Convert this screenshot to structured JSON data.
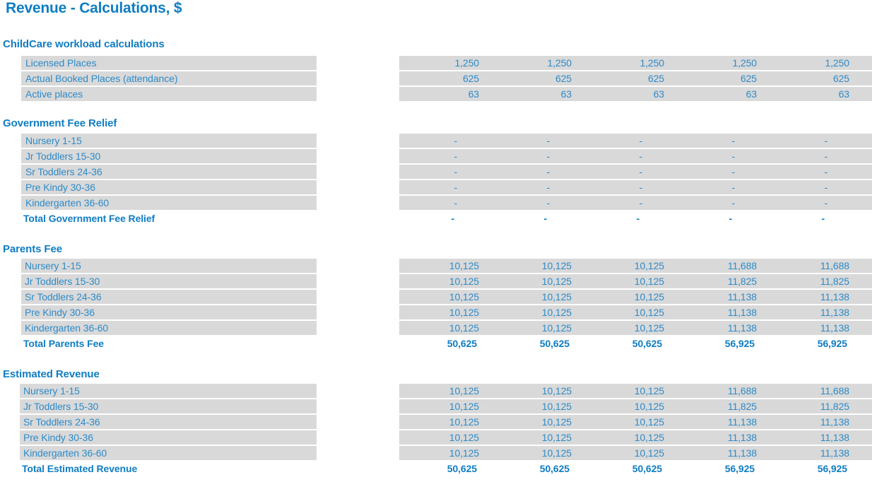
{
  "title": "Revenue - Calculations, $",
  "colors": {
    "heading_blue": "#0f7dc2",
    "body_blue": "#2e8bc8",
    "band_gray": "#d9d9d9",
    "background": "#ffffff"
  },
  "sections": [
    {
      "id": "childcare-workload",
      "header": "ChildCare workload calculations",
      "rows": [
        {
          "label": "Licensed Places",
          "values": [
            "1,250",
            "1,250",
            "1,250",
            "1,250",
            "1,250"
          ],
          "total": false
        },
        {
          "label": "Actual Booked Places (attendance)",
          "values": [
            "625",
            "625",
            "625",
            "625",
            "625"
          ],
          "total": false
        },
        {
          "label": "Active places",
          "values": [
            "63",
            "63",
            "63",
            "63",
            "63"
          ],
          "total": false
        }
      ]
    },
    {
      "id": "government-fee-relief",
      "header": "Government Fee Relief",
      "rows": [
        {
          "label": "Nursery 1-15",
          "values": [
            "-",
            "-",
            "-",
            "-",
            "-"
          ],
          "total": false
        },
        {
          "label": "Jr Toddlers 15-30",
          "values": [
            "-",
            "-",
            "-",
            "-",
            "-"
          ],
          "total": false
        },
        {
          "label": "Sr Toddlers 24-36",
          "values": [
            "-",
            "-",
            "-",
            "-",
            "-"
          ],
          "total": false
        },
        {
          "label": "Pre Kindy 30-36",
          "values": [
            "-",
            "-",
            "-",
            "-",
            "-"
          ],
          "total": false
        },
        {
          "label": "Kindergarten 36-60",
          "values": [
            "-",
            "-",
            "-",
            "-",
            "-"
          ],
          "total": false
        },
        {
          "label": "Total Government Fee Relief",
          "values": [
            "-",
            "-",
            "-",
            "-",
            "-"
          ],
          "total": true
        }
      ]
    },
    {
      "id": "parents-fee",
      "header": "Parents Fee",
      "rows": [
        {
          "label": "Nursery 1-15",
          "values": [
            "10,125",
            "10,125",
            "10,125",
            "11,688",
            "11,688"
          ],
          "total": false
        },
        {
          "label": "Jr Toddlers 15-30",
          "values": [
            "10,125",
            "10,125",
            "10,125",
            "11,825",
            "11,825"
          ],
          "total": false
        },
        {
          "label": "Sr Toddlers 24-36",
          "values": [
            "10,125",
            "10,125",
            "10,125",
            "11,138",
            "11,138"
          ],
          "total": false
        },
        {
          "label": "Pre Kindy 30-36",
          "values": [
            "10,125",
            "10,125",
            "10,125",
            "11,138",
            "11,138"
          ],
          "total": false
        },
        {
          "label": "Kindergarten 36-60",
          "values": [
            "10,125",
            "10,125",
            "10,125",
            "11,138",
            "11,138"
          ],
          "total": false
        },
        {
          "label": "Total Parents Fee",
          "values": [
            "50,625",
            "50,625",
            "50,625",
            "56,925",
            "56,925"
          ],
          "total": true
        }
      ]
    },
    {
      "id": "estimated-revenue",
      "header": "Estimated Revenue",
      "rows": [
        {
          "label": "Nursery 1-15",
          "values": [
            "10,125",
            "10,125",
            "10,125",
            "11,688",
            "11,688"
          ],
          "total": false
        },
        {
          "label": "Jr Toddlers 15-30",
          "values": [
            "10,125",
            "10,125",
            "10,125",
            "11,825",
            "11,825"
          ],
          "total": false
        },
        {
          "label": "Sr Toddlers 24-36",
          "values": [
            "10,125",
            "10,125",
            "10,125",
            "11,138",
            "11,138"
          ],
          "total": false
        },
        {
          "label": "Pre Kindy 30-36",
          "values": [
            "10,125",
            "10,125",
            "10,125",
            "11,138",
            "11,138"
          ],
          "total": false
        },
        {
          "label": "Kindergarten 36-60",
          "values": [
            "10,125",
            "10,125",
            "10,125",
            "11,138",
            "11,138"
          ],
          "total": false
        },
        {
          "label": "Total Estimated Revenue",
          "values": [
            "50,625",
            "50,625",
            "50,625",
            "56,925",
            "56,925"
          ],
          "total": true
        }
      ]
    }
  ]
}
